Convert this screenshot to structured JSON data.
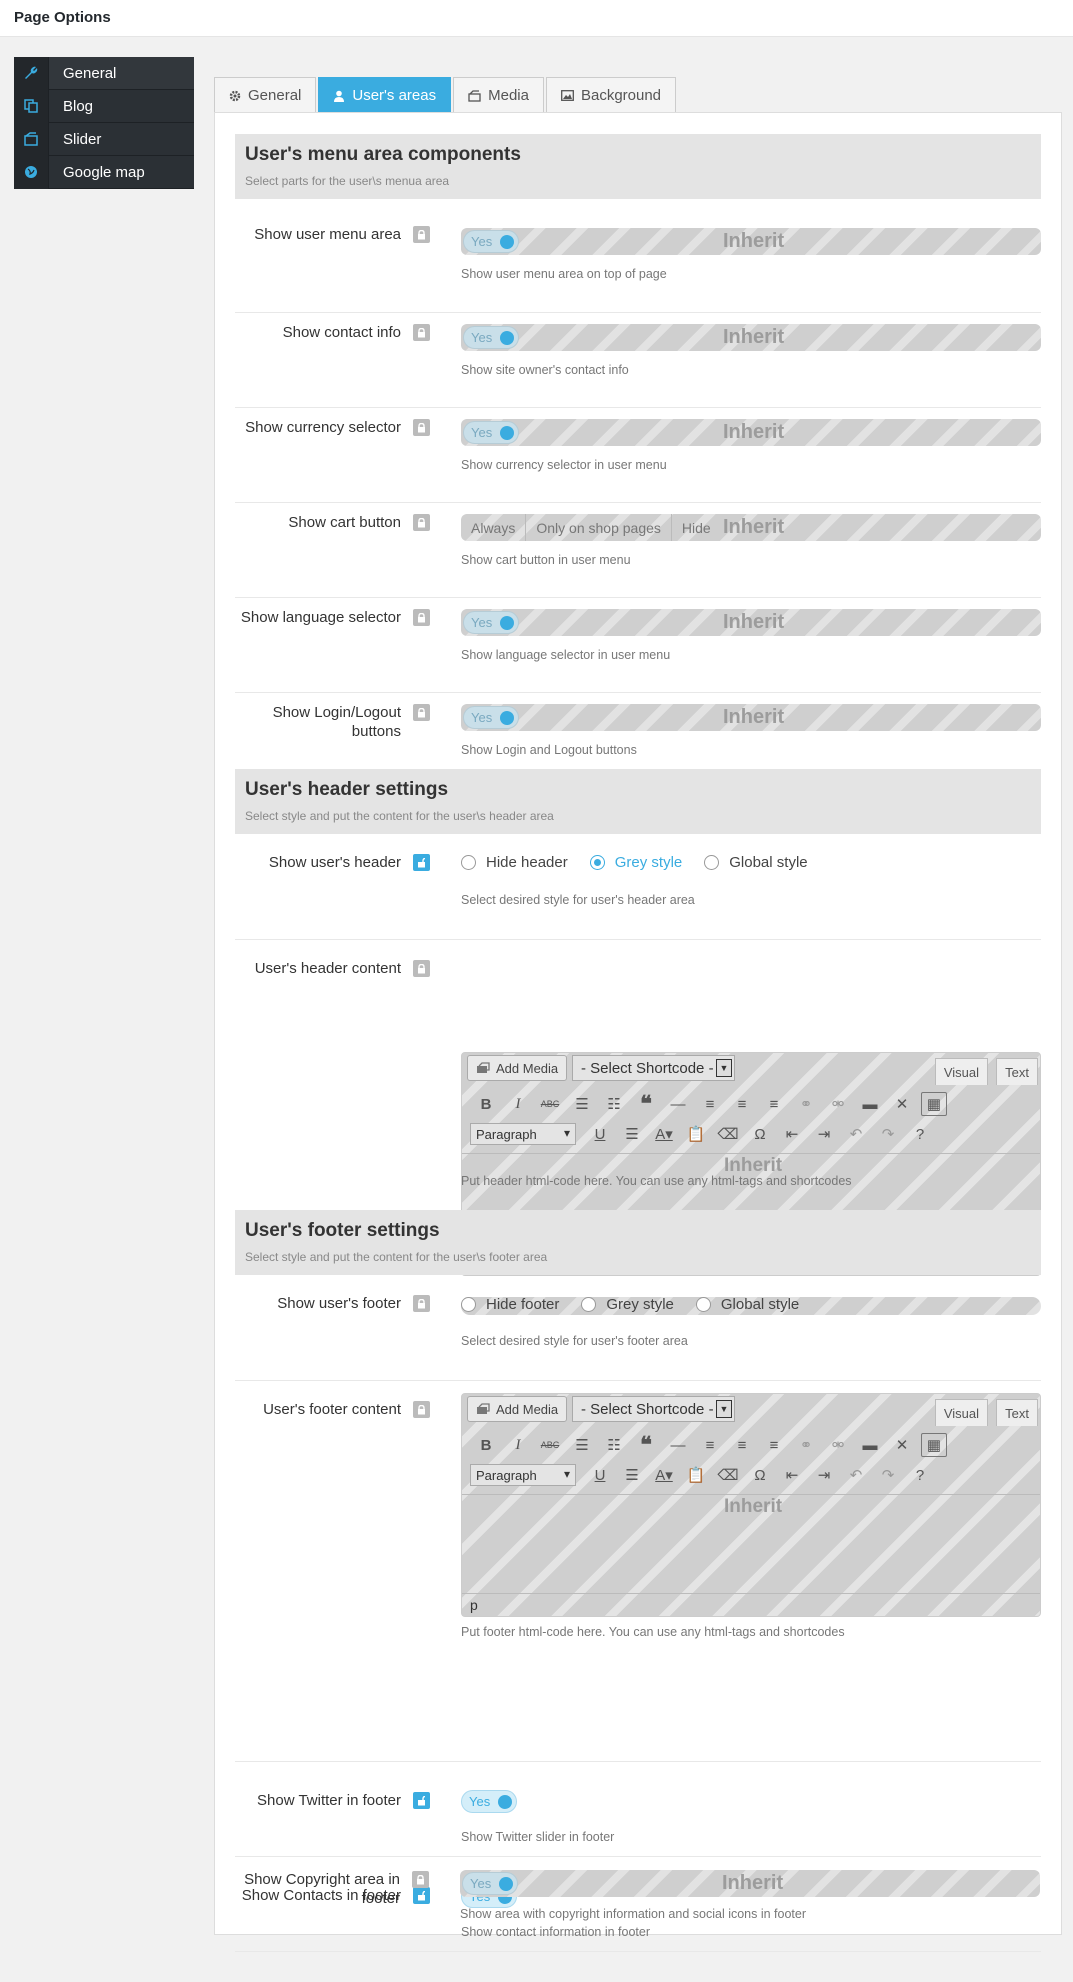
{
  "page_title": "Page Options",
  "sidebar": [
    {
      "label": "General",
      "icon": "wrench-icon"
    },
    {
      "label": "Blog",
      "icon": "copy-icon"
    },
    {
      "label": "Slider",
      "icon": "slider-icon"
    },
    {
      "label": "Google map",
      "icon": "globe-icon"
    }
  ],
  "tabs": [
    {
      "label": "General"
    },
    {
      "label": "User's areas"
    },
    {
      "label": "Media"
    },
    {
      "label": "Background"
    }
  ],
  "inherit_text": "Inherit",
  "yes_text": "Yes",
  "menu_section": {
    "title": "User's menu area components",
    "subtitle": "Select parts for the user\\s menua area"
  },
  "header_section": {
    "title": "User's header settings",
    "subtitle": "Select style and put the content for the user\\s header area"
  },
  "footer_section": {
    "title": "User's footer settings",
    "subtitle": "Select style and put the content for the user\\s footer area"
  },
  "rows": {
    "user_menu": {
      "label": "Show user menu area",
      "desc": "Show user menu area on top of page"
    },
    "contact_info": {
      "label": "Show contact info",
      "desc": "Show site owner's contact info"
    },
    "currency": {
      "label": "Show currency selector",
      "desc": "Show currency selector in user menu"
    },
    "cart": {
      "label": "Show cart button",
      "desc": "Show cart button in user menu",
      "options": [
        "Always",
        "Only on shop pages",
        "Hide"
      ]
    },
    "language": {
      "label": "Show language selector",
      "desc": "Show language selector in user menu"
    },
    "login": {
      "label": "Show Login/Logout buttons",
      "desc": "Show Login and Logout buttons"
    },
    "show_header": {
      "label": "Show user's header",
      "desc": "Select desired style for user's header area",
      "options": [
        "Hide header",
        "Grey style",
        "Global style"
      ],
      "selected": "Grey style"
    },
    "header_content": {
      "label": "User's header content",
      "desc": "Put header html-code here. You can use any html-tags and shortcodes"
    },
    "show_footer": {
      "label": "Show user's footer",
      "desc": "Select desired style for user's footer area",
      "options": [
        "Hide footer",
        "Grey style",
        "Global style"
      ]
    },
    "footer_content": {
      "label": "User's footer content",
      "desc": "Put footer html-code here. You can use any html-tags and shortcodes"
    },
    "twitter": {
      "label": "Show Twitter in footer",
      "desc": "Show Twitter slider in footer"
    },
    "contacts": {
      "label": "Show Contacts in footer",
      "desc": "Show contact information in footer"
    },
    "copyright": {
      "label": "Show Copyright area in footer",
      "desc": "Show area with copyright information and social icons in footer"
    }
  },
  "editor": {
    "add_media": "Add Media",
    "shortcode": "- Select Shortcode -",
    "visual": "Visual",
    "text": "Text",
    "paragraph": "Paragraph",
    "status": "p"
  },
  "colors": {
    "accent": "#3aace0",
    "sidebar": "#2b3035"
  }
}
